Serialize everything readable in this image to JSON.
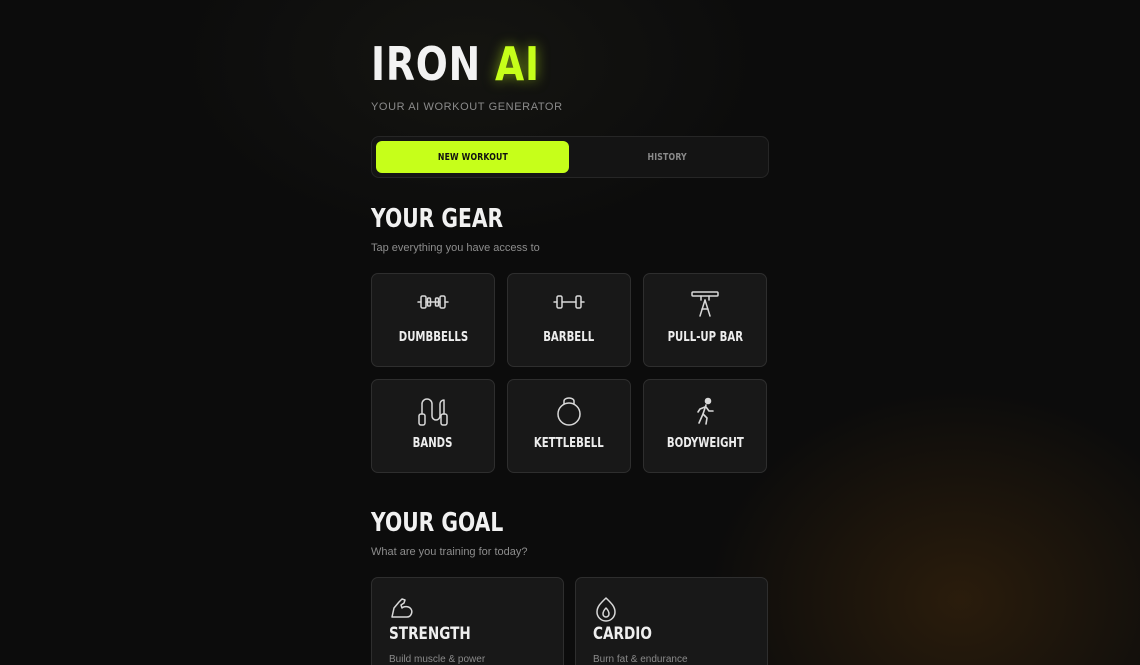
{
  "brand": {
    "name_main": "IRON",
    "name_accent": "AI",
    "tagline": "YOUR AI WORKOUT GENERATOR",
    "accent_color": "#c6ff1a"
  },
  "tabs": [
    {
      "label": "NEW WORKOUT",
      "active": true
    },
    {
      "label": "HISTORY",
      "active": false
    }
  ],
  "gear": {
    "title": "YOUR GEAR",
    "subtitle": "Tap everything you have access to",
    "items": [
      {
        "label": "DUMBBELLS",
        "icon": "dumbbell-icon"
      },
      {
        "label": "BARBELL",
        "icon": "barbell-icon"
      },
      {
        "label": "PULL-UP BAR",
        "icon": "pull-up-bar-icon"
      },
      {
        "label": "BANDS",
        "icon": "resistance-bands-icon"
      },
      {
        "label": "KETTLEBELL",
        "icon": "kettlebell-icon"
      },
      {
        "label": "BODYWEIGHT",
        "icon": "running-person-icon"
      }
    ]
  },
  "goal": {
    "title": "YOUR GOAL",
    "subtitle": "What are you training for today?",
    "items": [
      {
        "title": "STRENGTH",
        "desc": "Build muscle & power",
        "icon": "flexed-bicep-icon"
      },
      {
        "title": "CARDIO",
        "desc": "Burn fat & endurance",
        "icon": "flame-icon"
      }
    ]
  }
}
